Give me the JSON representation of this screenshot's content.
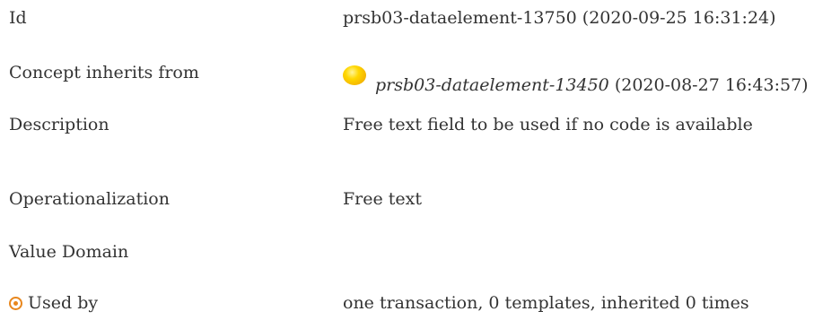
{
  "rows": {
    "id": {
      "label": "Id",
      "value": "prsb03-dataelement-13750 (2020-09-25 16:31:24)"
    },
    "inherits": {
      "label": "Concept inherits from",
      "ref_name": "prsb03-dataelement-13450",
      "ref_date": " (2020-08-27 16:43:57)"
    },
    "description": {
      "label": "Description",
      "value": "Free text field to be used if no code is available"
    },
    "operationalization": {
      "label": "Operationalization",
      "value": "Free text"
    },
    "value_domain": {
      "label": "Value Domain",
      "value": ""
    },
    "used_by": {
      "label": "Used by",
      "value": "one transaction, 0 templates, inherited 0 times"
    }
  },
  "colors": {
    "text": "#333333",
    "status_ball": "#ffd700",
    "used_by_icon": "#e8871e"
  }
}
